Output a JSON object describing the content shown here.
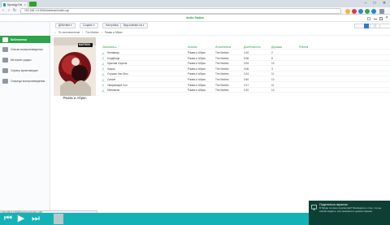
{
  "browser": {
    "tab_title": "Synology DiskStation",
    "url": "192.168.1.6:5000/webman/index.cgi"
  },
  "app": {
    "title": "Audio Station"
  },
  "sidebar": {
    "items": [
      {
        "label": "Библиотека",
        "active": true
      },
      {
        "label": "Списки воспроизведения",
        "active": false
      },
      {
        "label": "Интернет-радио",
        "active": false
      },
      {
        "label": "Сервер мультимедиа",
        "active": false
      },
      {
        "label": "Очереди воспроизведения",
        "active": false
      }
    ]
  },
  "toolbar": {
    "buttons": [
      "Действие ▾",
      "Создать ▾",
      "Настройка",
      "Вид компакт-на ▾"
    ]
  },
  "breadcrumb": {
    "items": [
      "По исполнителям",
      "›",
      "The Matrixx",
      "›",
      "Ржавь и Абрис"
    ]
  },
  "album": {
    "caption": "Ржавь и Абрис",
    "cover_label": "MATRIXX"
  },
  "table": {
    "headers": [
      "Заголовок ▴",
      "Альбом",
      "Исполнитель",
      "Длительность",
      "Дорожка",
      "Рейтинг"
    ],
    "rows": [
      {
        "title": "Ненавижу",
        "album": "Ржавь и Абрис",
        "artist": "The Matrixx",
        "duration": "4:10",
        "track": "2"
      },
      {
        "title": "Кладбище",
        "album": "Ржавь и Абрис",
        "artist": "The Matrixx",
        "duration": "5:36",
        "track": "8"
      },
      {
        "title": "Красная Сирена",
        "album": "Ржавь и Абрис",
        "artist": "The Matrixx",
        "duration": "3:04",
        "track": "10"
      },
      {
        "title": "Кошка",
        "album": "Ржавь и Абрис",
        "artist": "The Matrixx",
        "duration": "3:06",
        "track": "3"
      },
      {
        "title": "Слушая Час Dino",
        "album": "Ржавь и Абрис",
        "artist": "The Matrixx",
        "duration": "3:14",
        "track": "11"
      },
      {
        "title": "Сансет",
        "album": "Ржавь и Абрис",
        "artist": "The Matrixx",
        "duration": "3:40",
        "track": "10"
      },
      {
        "title": "Умирающий Сон",
        "album": "Ржавь и Абрис",
        "artist": "The Matrixx",
        "duration": "4:17",
        "track": "11"
      },
      {
        "title": "Механизм",
        "album": "Ржавь и Абрис",
        "artist": "The Matrixx",
        "duration": "3:10",
        "track": "14"
      }
    ]
  },
  "status": {
    "url": "192.168.1.6:5000/webman/index.cgi#"
  },
  "toast": {
    "title": "Поделиться экраном",
    "message": "В Skype ли окно просмотра? Поговорите о том, что вы сейчас видите, или прекратите демонстрацию."
  },
  "colors": {
    "accent": "#2aa34a",
    "player_bar": "#14b2b7",
    "toast_bg": "#0e3f34"
  }
}
